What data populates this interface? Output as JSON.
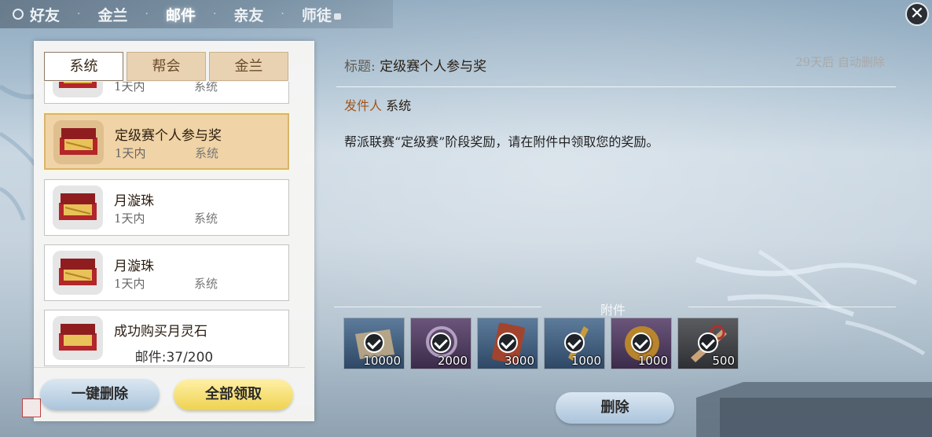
{
  "nav": {
    "tabs": [
      {
        "label": "好友"
      },
      {
        "label": "金兰"
      },
      {
        "label": "邮件"
      },
      {
        "label": "亲友"
      },
      {
        "label": "师徒"
      }
    ]
  },
  "close": {
    "label": "✕"
  },
  "mailbox": {
    "subtabs": [
      {
        "label": "系统"
      },
      {
        "label": "帮会"
      },
      {
        "label": "金兰"
      }
    ],
    "items": [
      {
        "title": "",
        "date": "1天内",
        "sender": "系统"
      },
      {
        "title": "定级赛个人参与奖",
        "date": "1天内",
        "sender": "系统"
      },
      {
        "title": "月漩珠",
        "date": "1天内",
        "sender": "系统"
      },
      {
        "title": "月漩珠",
        "date": "1天内",
        "sender": "系统"
      },
      {
        "title": "成功购买月灵石",
        "date": "",
        "sender": ""
      }
    ],
    "count": "邮件:37/200",
    "delete_all": "一键删除",
    "claim_all": "全部领取"
  },
  "detail": {
    "subject_key": "标题:",
    "subject_value": "定级赛个人参与奖",
    "auto_delete": "29天后 自动删除",
    "sender_key": "发件人",
    "sender_value": "系统",
    "body": "帮派联赛“定级赛”阶段奖励，请在附件中领取您的奖励。",
    "attachments_label": "附件",
    "attachments": [
      {
        "qty": "10000",
        "icon": "scroll-icon"
      },
      {
        "qty": "2000",
        "icon": "ornament-icon"
      },
      {
        "qty": "3000",
        "icon": "card-icon"
      },
      {
        "qty": "1000",
        "icon": "token-icon"
      },
      {
        "qty": "1000",
        "icon": "medal-icon"
      },
      {
        "qty": "500",
        "icon": "blade-icon"
      }
    ],
    "delete": "删除"
  },
  "colors": {
    "selected_item": "#f0d3a6",
    "claim_button": "#efd24f",
    "delete_button": "#aac4db"
  }
}
